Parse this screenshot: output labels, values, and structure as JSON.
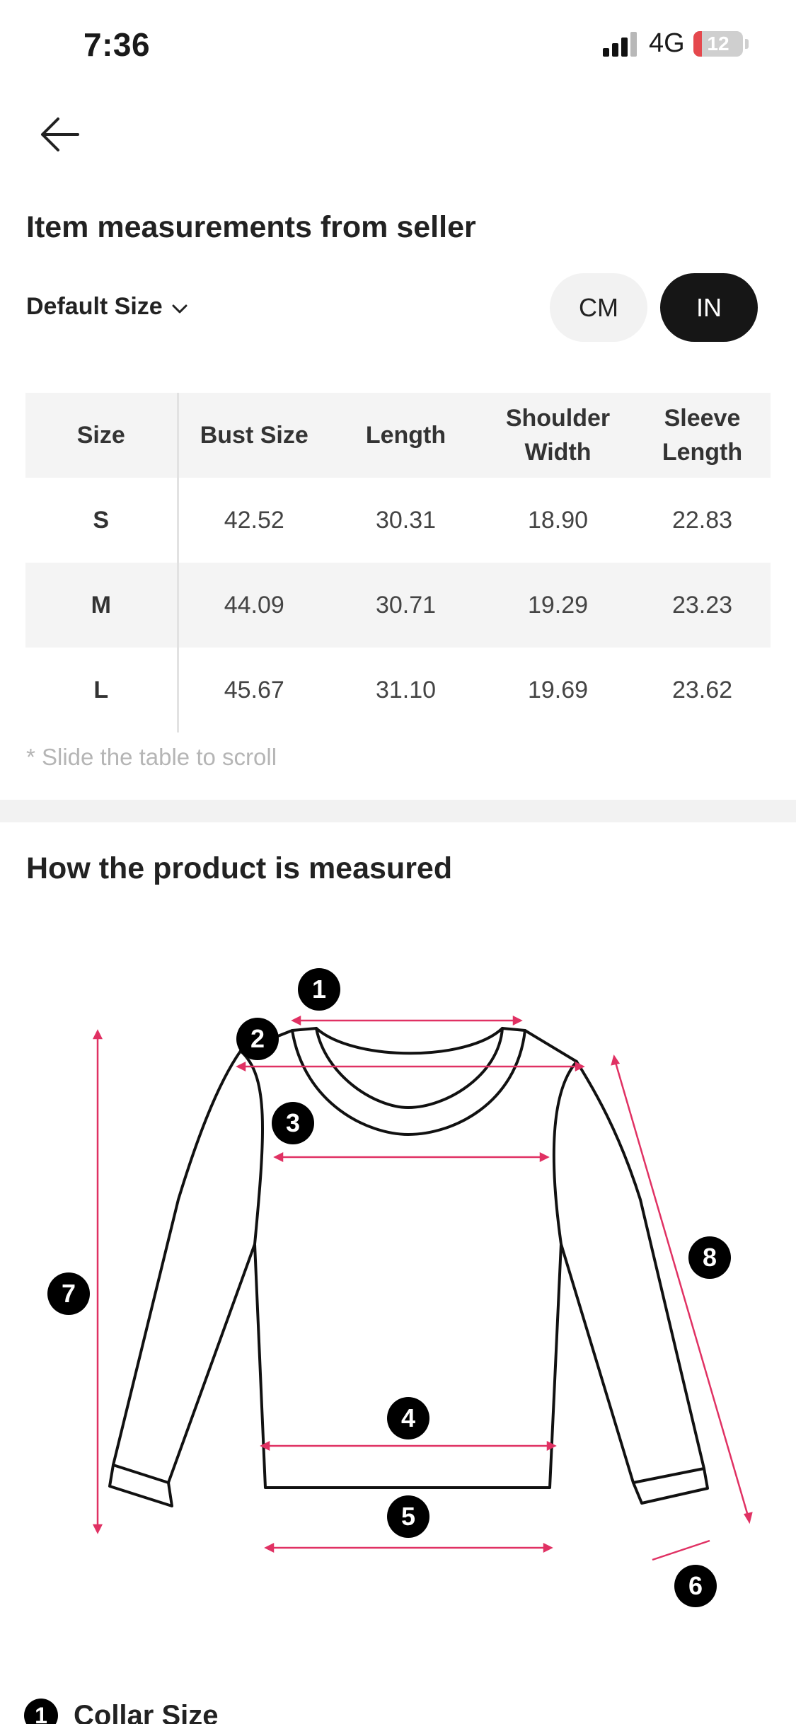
{
  "status_bar": {
    "time": "7:36",
    "network": "4G",
    "battery_level": "12"
  },
  "header": {
    "back_icon": "arrow-left-icon",
    "title": "Item measurements from seller"
  },
  "size_selector": {
    "label": "Default Size"
  },
  "units": {
    "cm_label": "CM",
    "in_label": "IN",
    "selected": "IN"
  },
  "table": {
    "headers": [
      "Size",
      "Bust Size",
      "Length",
      "Shoulder Width",
      "Sleeve Length"
    ],
    "rows": [
      [
        "S",
        "42.52",
        "30.31",
        "18.90",
        "22.83"
      ],
      [
        "M",
        "44.09",
        "30.71",
        "19.29",
        "23.23"
      ],
      [
        "L",
        "45.67",
        "31.10",
        "19.69",
        "23.62"
      ]
    ],
    "scroll_hint": "* Slide the table to scroll"
  },
  "measure_section": {
    "title": "How the product is measured",
    "markers": [
      "1",
      "2",
      "3",
      "4",
      "5",
      "6",
      "7",
      "8"
    ],
    "accent_color": "#e03163"
  },
  "legend": [
    {
      "num": "1",
      "label": "Collar Size"
    }
  ]
}
